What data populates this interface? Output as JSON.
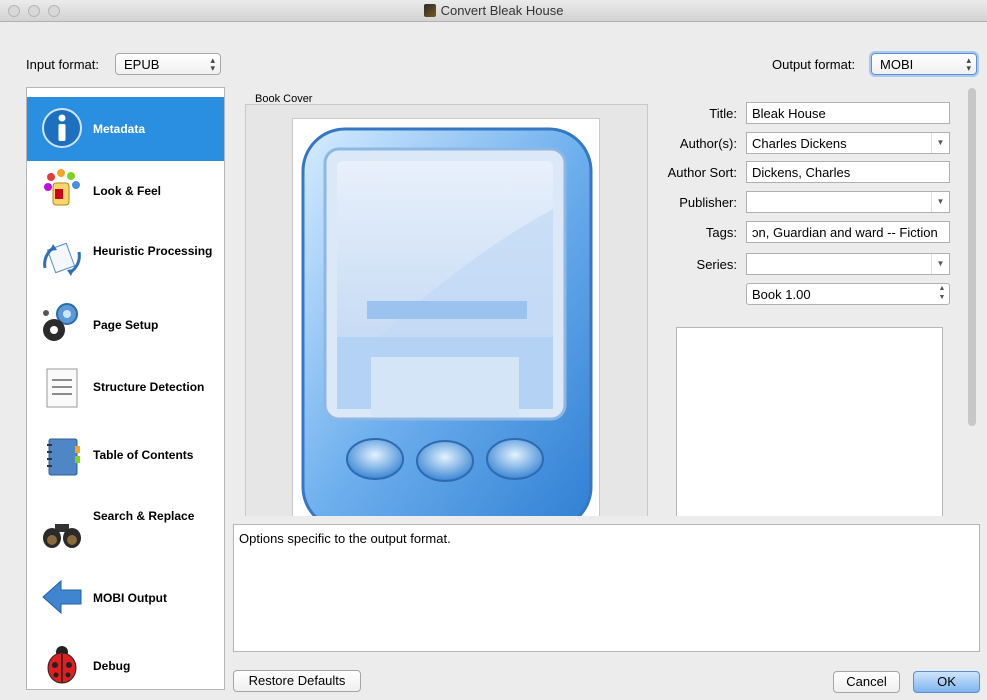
{
  "window": {
    "title": "Convert Bleak House"
  },
  "input_format": {
    "label": "Input format:",
    "value": "EPUB"
  },
  "output_format": {
    "label": "Output format:",
    "value": "MOBI"
  },
  "sidebar": {
    "items": [
      {
        "label": "Metadata",
        "icon": "info-icon",
        "active": true
      },
      {
        "label": "Look & Feel",
        "icon": "palette-icon"
      },
      {
        "label": "Heuristic Processing",
        "icon": "heuristic-icon"
      },
      {
        "label": "Page Setup",
        "icon": "gears-icon"
      },
      {
        "label": "Structure Detection",
        "icon": "document-icon"
      },
      {
        "label": "Table of Contents",
        "icon": "notebook-icon"
      },
      {
        "label": "Search & Replace",
        "icon": "binoculars-icon"
      },
      {
        "label": "MOBI Output",
        "icon": "arrow-left-icon"
      },
      {
        "label": "Debug",
        "icon": "ladybug-icon"
      }
    ]
  },
  "cover": {
    "label": "Book Cover"
  },
  "metadata": {
    "title_label": "Title:",
    "title_value": "Bleak House",
    "authors_label": "Author(s):",
    "authors_value": "Charles Dickens",
    "author_sort_label": "Author Sort:",
    "author_sort_value": "Dickens, Charles",
    "publisher_label": "Publisher:",
    "publisher_value": "",
    "tags_label": "Tags:",
    "tags_value": "ɔn, Guardian and ward -- Fiction",
    "series_label": "Series:",
    "series_value": "",
    "series_index": "Book 1.00"
  },
  "description": "Options specific to the output format.",
  "buttons": {
    "restore_defaults": "Restore Defaults",
    "cancel": "Cancel",
    "ok": "OK"
  },
  "colors": {
    "accent": "#2a8fe0",
    "sidebar_active_text": "#ffffff"
  }
}
